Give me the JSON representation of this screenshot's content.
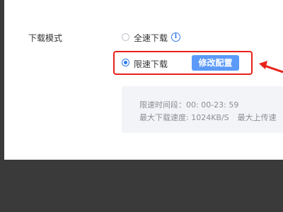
{
  "download_mode": {
    "label": "下载模式",
    "options": [
      {
        "label": "全速下载",
        "selected": false
      },
      {
        "label": "限速下载",
        "selected": true
      }
    ],
    "modify_button": "修改配置"
  },
  "speed_limit_info": {
    "time_period_label": "限速时间段：",
    "time_period_value": "00: 00-23: 59",
    "max_download_label": "最大下载速度: ",
    "max_download_value": "1024KB/S",
    "max_upload_label": "最大上传速"
  },
  "colors": {
    "accent": "#2f78e8",
    "button": "#5b9af8",
    "annotation": "#e8211a",
    "backdrop": "#3a3a3a"
  },
  "icons": [
    "info-icon",
    "annotation-arrow-icon"
  ]
}
